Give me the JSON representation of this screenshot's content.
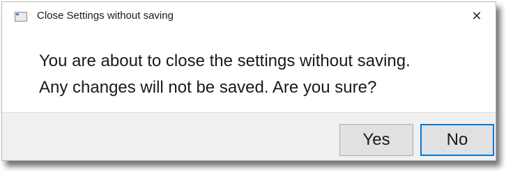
{
  "window": {
    "title": "Close Settings without saving",
    "close_glyph": "✕"
  },
  "message": {
    "line1": "You are about to close the settings without saving.",
    "line2": "Any changes will not be saved. Are you sure?"
  },
  "buttons": {
    "yes_label": "Yes",
    "no_label": "No",
    "default": "No"
  },
  "colors": {
    "focus_border": "#0078d7",
    "footer_bg": "#f0f0f0"
  },
  "icons": {
    "app": "app-window-icon",
    "close": "close-icon"
  }
}
